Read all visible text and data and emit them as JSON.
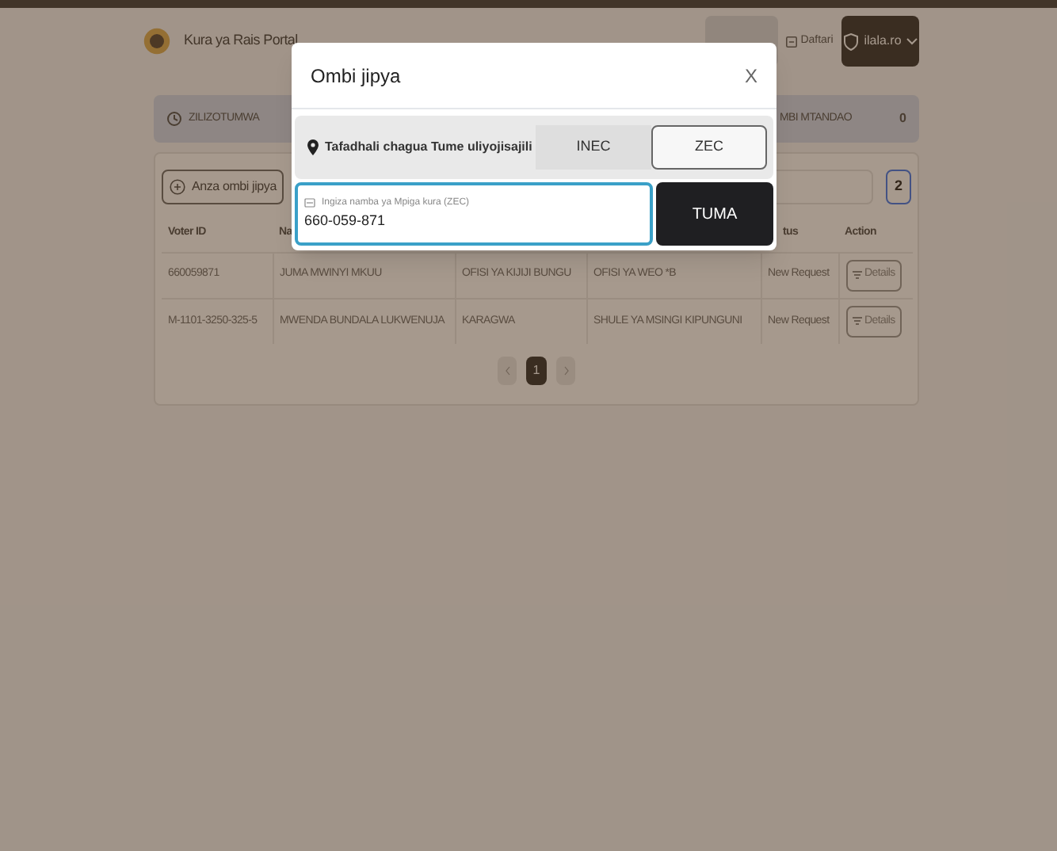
{
  "header": {
    "title": "Kura ya Rais Portal",
    "nav": [
      {
        "selected": true
      },
      {
        "label": "Daftari",
        "selected": false
      }
    ],
    "user": "ilala.ro"
  },
  "stats": [
    {
      "label": "ZILIZOTUMWA"
    },
    {
      "label": "MBI MTANDAO",
      "count": "0"
    }
  ],
  "toolbar": {
    "new_button": "Anza ombi jipya",
    "page_size": "2"
  },
  "table": {
    "columns": [
      {
        "label": "Voter ID"
      },
      {
        "label": "Na"
      },
      {},
      {},
      {
        "label": "tus"
      },
      {
        "label": "Action"
      }
    ],
    "rows": [
      {
        "cells": [
          "660059871",
          "JUMA MWINYI MKUU",
          "OFISI YA KIJIJI BUNGU",
          "OFISI YA WEO *B",
          "New Request"
        ],
        "action": "Details"
      },
      {
        "cells": [
          "M-1101-3250-325-5",
          "MWENDA BUNDALA LUKWENUJA",
          "KARAGWA",
          "SHULE YA MSINGI KIPUNGUNI",
          "New Request"
        ],
        "action": "Details"
      }
    ]
  },
  "pagination": {
    "pages": [
      {
        "label": "1",
        "selected": true
      }
    ]
  },
  "modal": {
    "title": "Ombi jipya",
    "close": "X",
    "prompt": "Tafadhali chagua Tume uliyojisajili",
    "options": [
      {
        "label": "INEC",
        "selected": false
      },
      {
        "label": "ZEC",
        "selected": true
      }
    ],
    "input": {
      "label": "Ingiza namba ya Mpiga kura (ZEC)",
      "value": "660-059-871",
      "focused": true
    },
    "submit": "TUMA"
  }
}
